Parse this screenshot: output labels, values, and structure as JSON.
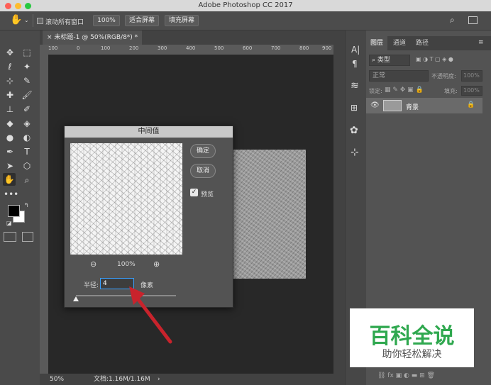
{
  "window": {
    "title": "Adobe Photoshop CC 2017",
    "traffic_colors": [
      "#fe5f57",
      "#febc2e",
      "#28c840"
    ]
  },
  "options": {
    "scroll_all_label": "滚动所有窗口",
    "zoom_100": "100%",
    "fit_screen": "适合屏幕",
    "fill_screen": "填充屏幕"
  },
  "document": {
    "tab_label": "未标题-1 @ 50%(RGB/8*) *",
    "ruler_marks": [
      "100",
      "0",
      "100",
      "200",
      "300",
      "400",
      "500",
      "600",
      "700",
      "800",
      "900"
    ],
    "status_zoom": "50%",
    "status_doc": "文档:1.16M/1.16M"
  },
  "dialog": {
    "title": "中间值",
    "ok": "确定",
    "cancel": "取消",
    "preview_label": "预览",
    "preview_checked": true,
    "zoom_level": "100%",
    "radius_label": "半径:",
    "radius_value": "4",
    "radius_unit": "像素"
  },
  "layers_panel": {
    "tabs": [
      "图层",
      "通道",
      "路径"
    ],
    "filter_kind": "类型",
    "blend_mode": "正常",
    "opacity_label": "不透明度:",
    "opacity_value": "100%",
    "lock_label": "锁定:",
    "fill_label": "填充:",
    "fill_value": "100%",
    "layer_name": "背景"
  },
  "watermark": {
    "title": "百科全说",
    "subtitle": "助你轻松解决",
    "color": "#2fa84f"
  },
  "colors": {
    "annotation_arrow": "#c8232c",
    "foreground": "#000000",
    "background": "#ffffff",
    "focus": "#3aa0ff"
  }
}
